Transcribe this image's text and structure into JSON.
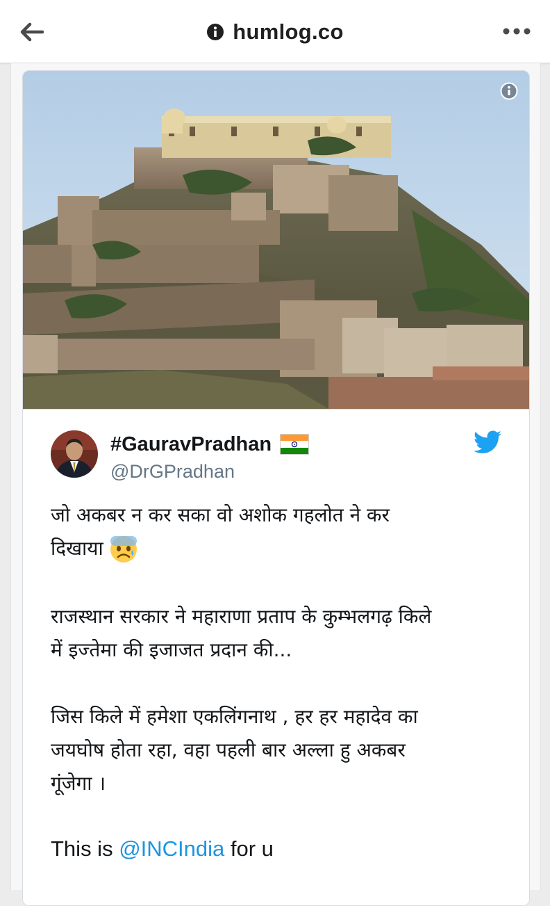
{
  "browser": {
    "url": "humlog.co",
    "icons": {
      "back": "arrow-left-icon",
      "info": "info-icon",
      "menu": "more-horizontal-icon"
    }
  },
  "image": {
    "description_icon": "info-icon"
  },
  "tweet": {
    "display_name": "#GauravPradhan",
    "flag_icon": "india-flag-icon",
    "handle": "@DrGPradhan",
    "platform_icon": "twitter-bird-icon",
    "paragraph1_line1": "जो अकबर न कर सका वो अशोक गहलोत ने कर",
    "paragraph1_line2": "दिखाया",
    "emoji_icon": "anxious-face-emoji",
    "paragraph2_line1": "राजस्थान सरकार ने महाराणा प्रताप के कुम्भलगढ़ किले",
    "paragraph2_line2": "में इज्तेमा की इजाजत प्रदान की...",
    "paragraph3_line1": "जिस किले में हमेशा एकलिंगनाथ , हर हर महादेव का",
    "paragraph3_line2": "जयघोष होता रहा, वहा पहली बार अल्ला हु अकबर",
    "paragraph3_line3": "गूंजेगा ।",
    "paragraph4_prefix": "This is ",
    "paragraph4_mention": "@INCIndia",
    "paragraph4_suffix": " for u"
  },
  "colors": {
    "link": "#1b95e0",
    "handle": "#657786",
    "text": "#14171a"
  }
}
